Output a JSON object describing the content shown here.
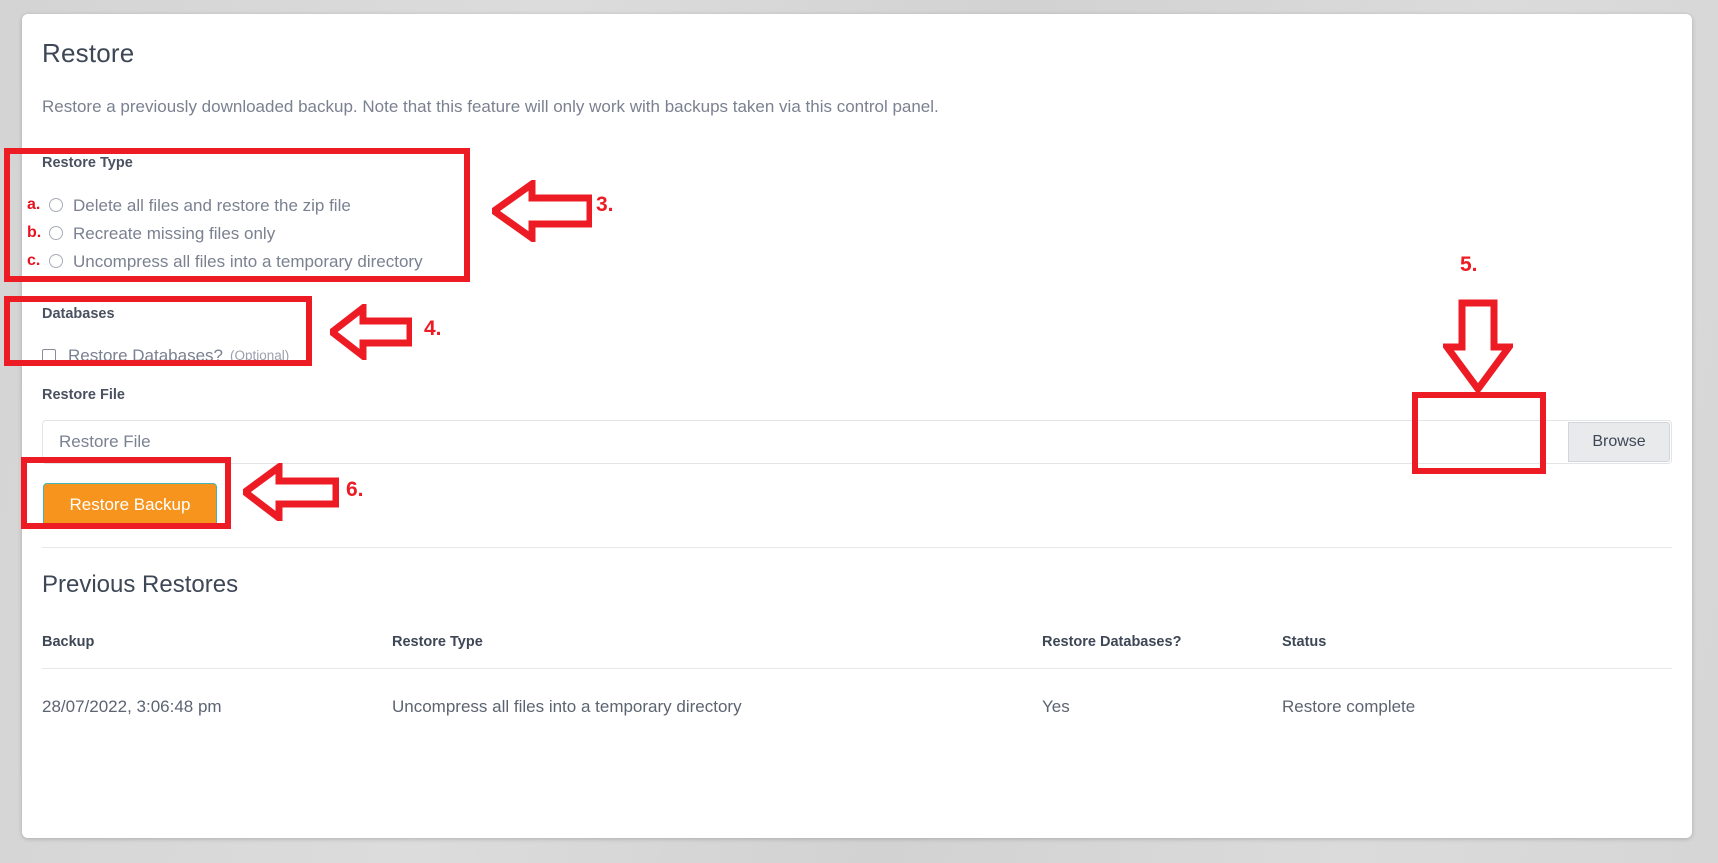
{
  "page": {
    "title": "Restore",
    "description": "Restore a previously downloaded backup. Note that this feature will only work with backups taken via this control panel."
  },
  "restore_type": {
    "label": "Restore Type",
    "options": [
      {
        "marker": "a.",
        "label": "Delete all files and restore the zip file",
        "checked": false
      },
      {
        "marker": "b.",
        "label": "Recreate missing files only",
        "checked": false
      },
      {
        "marker": "c.",
        "label": "Uncompress all files into a temporary directory",
        "checked": false
      }
    ]
  },
  "databases": {
    "label": "Databases",
    "checkbox_label": "Restore Databases?",
    "optional_note": "(Optional)",
    "checked": false
  },
  "restore_file": {
    "label": "Restore File",
    "placeholder": "Restore File",
    "value": "",
    "browse_label": "Browse"
  },
  "submit": {
    "label": "Restore Backup",
    "bg_color": "#f7941d",
    "border_color": "#43b3b8",
    "text_color": "#ffffff"
  },
  "previous_restores": {
    "title": "Previous Restores",
    "columns": [
      "Backup",
      "Restore Type",
      "Restore Databases?",
      "Status"
    ],
    "rows": [
      {
        "backup": "28/07/2022, 3:06:48 pm",
        "restore_type": "Uncompress all files into a temporary directory",
        "restore_databases": "Yes",
        "status": "Restore complete"
      }
    ]
  },
  "annotations": {
    "color": "#ed1c24",
    "markers": [
      {
        "id": "3",
        "label": "3."
      },
      {
        "id": "4",
        "label": "4."
      },
      {
        "id": "5",
        "label": "5."
      },
      {
        "id": "6",
        "label": "6."
      }
    ]
  }
}
